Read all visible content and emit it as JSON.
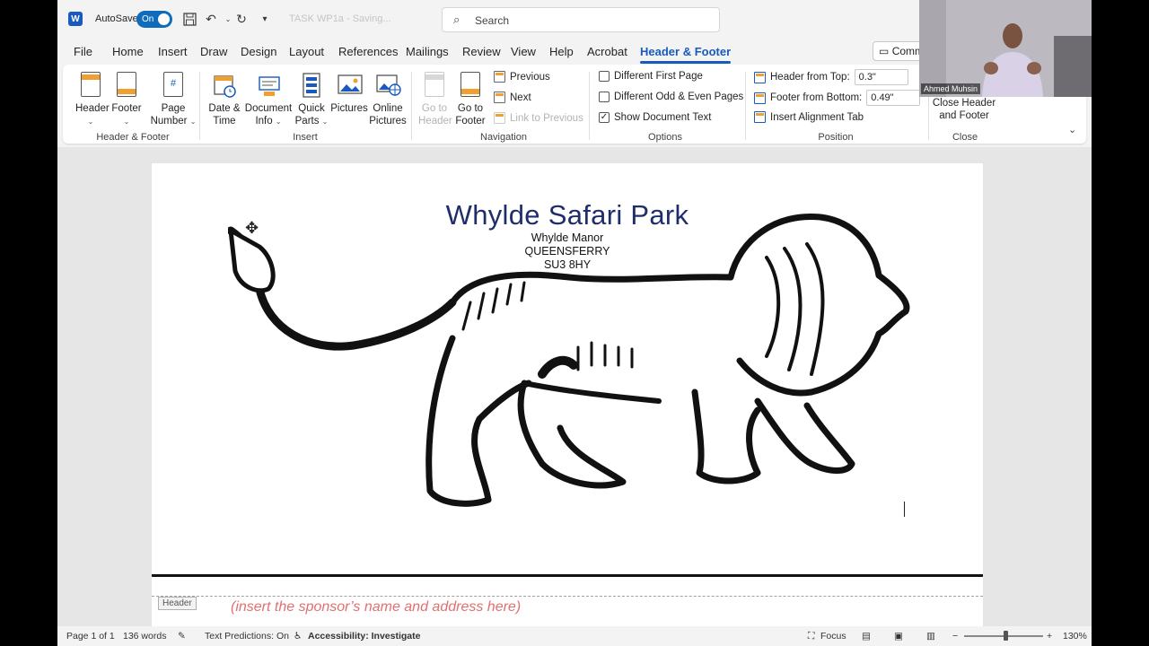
{
  "titlebar": {
    "autosave_label": "AutoSave",
    "autosave_state": "On",
    "doc_title": "TASK WP1a - Saving...",
    "search_placeholder": "Search"
  },
  "tabs": [
    "File",
    "Home",
    "Insert",
    "Draw",
    "Design",
    "Layout",
    "References",
    "Mailings",
    "Review",
    "View",
    "Help",
    "Acrobat",
    "Header & Footer"
  ],
  "active_tab": "Header & Footer",
  "comments_label": "Comm",
  "ribbon": {
    "header_footer_group": {
      "header": "Header",
      "footer": "Footer",
      "page_number_1": "Page",
      "page_number_2": "Number",
      "label": "Header & Footer"
    },
    "insert_group": {
      "date_time_1": "Date &",
      "date_time_2": "Time",
      "document_info_1": "Document",
      "document_info_2": "Info",
      "quick_parts_1": "Quick",
      "quick_parts_2": "Parts",
      "pictures": "Pictures",
      "online_pictures_1": "Online",
      "online_pictures_2": "Pictures",
      "label": "Insert"
    },
    "navigation_group": {
      "go_to_header_1": "Go to",
      "go_to_header_2": "Header",
      "go_to_footer_1": "Go to",
      "go_to_footer_2": "Footer",
      "previous": "Previous",
      "next": "Next",
      "link_to_previous": "Link to Previous",
      "label": "Navigation"
    },
    "options_group": {
      "different_first_page": "Different First Page",
      "different_odd_even": "Different Odd & Even Pages",
      "show_document_text": "Show Document Text",
      "label": "Options"
    },
    "position_group": {
      "header_from_top_label": "Header from Top:",
      "header_from_top_value": "0.3\"",
      "footer_from_bottom_label": "Footer from Bottom:",
      "footer_from_bottom_value": "0.49\"",
      "insert_alignment_tab": "Insert Alignment Tab",
      "label": "Position"
    },
    "close_group": {
      "close_1": "Close Header",
      "close_2": "and Footer",
      "label": "Close"
    }
  },
  "document": {
    "title": "Whylde Safari Park",
    "address_line_1": "Whylde Manor",
    "address_line_2": "QUEENSFERRY",
    "address_line_3": "SU3 8HY",
    "header_tag": "Header",
    "sponsor_placeholder": "(insert the sponsor’s name and address here)"
  },
  "statusbar": {
    "page": "Page 1 of 1",
    "words": "136 words",
    "text_predictions": "Text Predictions: On",
    "accessibility": "Accessibility: Investigate",
    "focus": "Focus",
    "zoom": "130%"
  },
  "webcam": {
    "name": "Ahmed Muhsin"
  },
  "colors": {
    "accent": "#185abd",
    "title_blue": "#1f2e6b",
    "sponsor_red": "#e07070"
  }
}
